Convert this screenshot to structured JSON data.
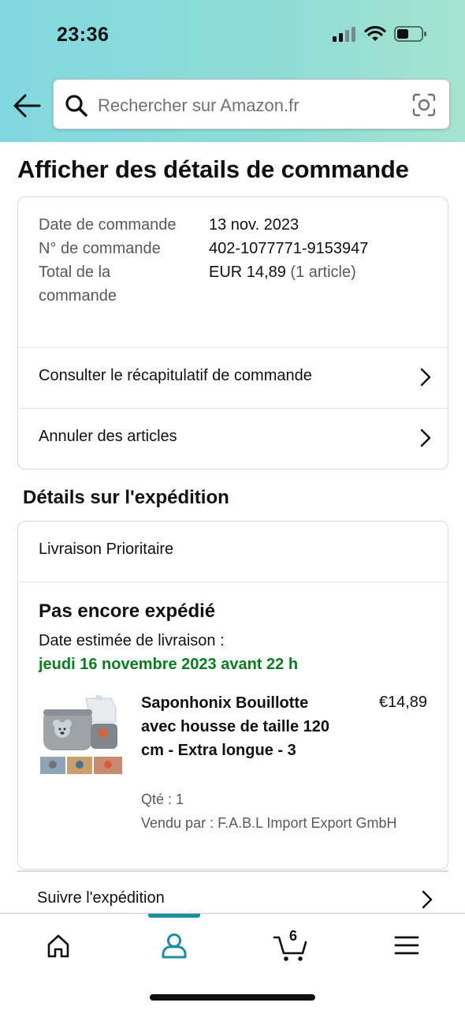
{
  "status_bar": {
    "time": "23:36"
  },
  "search": {
    "placeholder": "Rechercher sur Amazon.fr"
  },
  "page": {
    "title": "Afficher des détails de commande"
  },
  "order": {
    "date_label": "Date de commande",
    "date_value": "13 nov. 2023",
    "number_label": "N° de commande",
    "number_value": "402-1077771-9153947",
    "total_label": "Total de la commande",
    "total_value": "EUR 14,89",
    "total_count": "(1 article)",
    "summary_link": "Consulter le récapitulatif de commande",
    "cancel_link": "Annuler des articles"
  },
  "shipping": {
    "section_title": "Détails sur l'expédition",
    "method": "Livraison Prioritaire",
    "status": "Pas encore expédié",
    "estimate_label": "Date estimée de livraison :",
    "estimate_date": "jeudi 16 novembre 2023 avant 22 h",
    "item": {
      "name": "Saponhonix Bouillotte avec housse de taille 120 cm - Extra longue - 3",
      "price": "€14,89",
      "quantity": "Qté : 1",
      "seller": "Vendu par : F.A.B.L Import Export GmbH"
    },
    "track_link": "Suivre l'expédition"
  },
  "bottom_nav": {
    "cart_count": "6",
    "active": "account",
    "accent_color": "#1c8ea2"
  },
  "colors": {
    "delivery_green": "#067d20",
    "header_gradient": [
      "#82d8e0",
      "#a5e4cf"
    ]
  }
}
